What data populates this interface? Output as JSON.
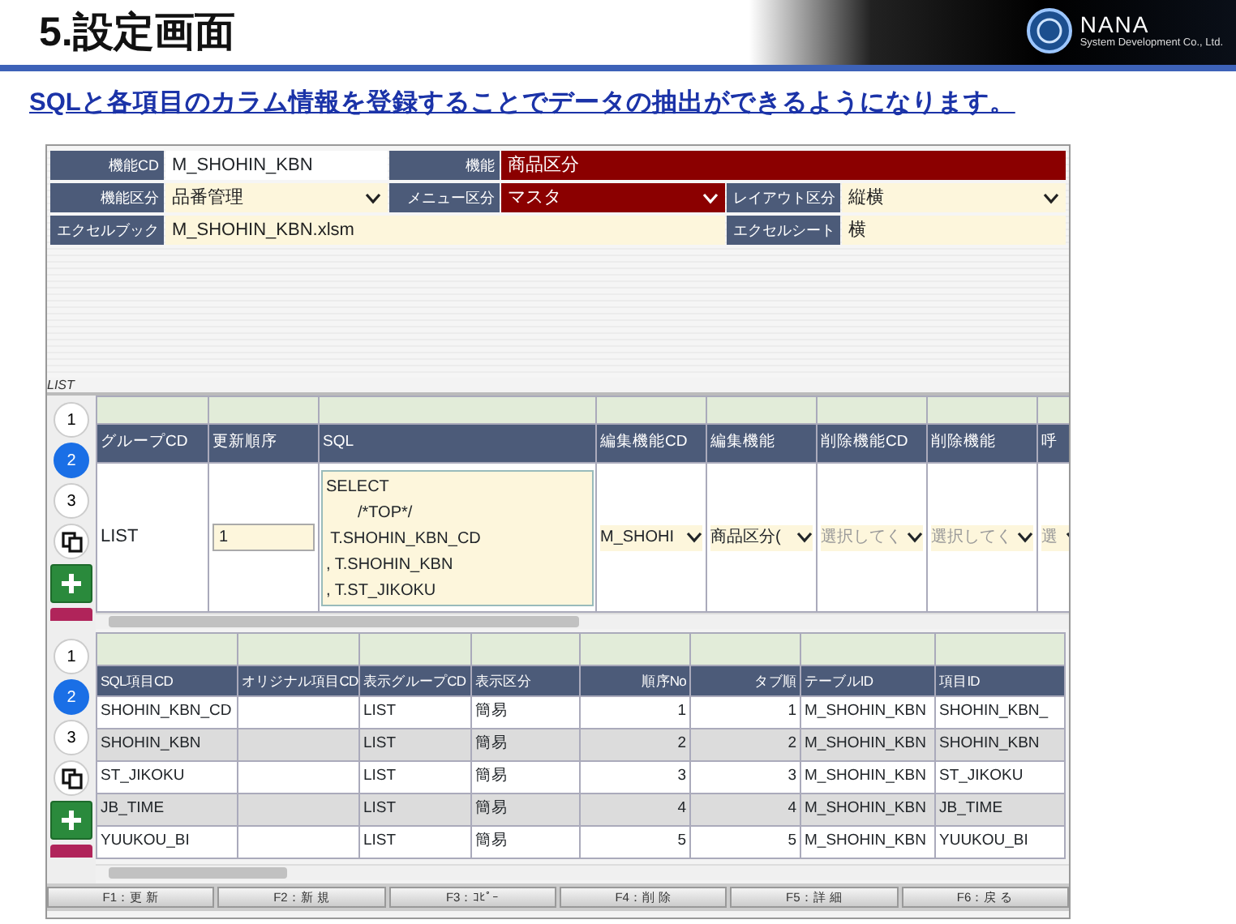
{
  "page_title": "5.設定画面",
  "logo": {
    "name": "NANA",
    "tagline": "System Development Co., Ltd."
  },
  "subtitle": "SQLと各項目のカラム情報を登録することでデータの抽出ができるようになります。",
  "form": {
    "fields": [
      {
        "label": "機能CD",
        "value": "M_SHOHIN_KBN",
        "kind": "key",
        "highlighted": false
      },
      {
        "label": "機能",
        "value": "商品区分",
        "kind": "text",
        "highlighted": true
      },
      {
        "label": "機能区分",
        "value": "品番管理",
        "kind": "select",
        "highlighted": false
      },
      {
        "label": "メニュー区分",
        "value": "マスタ",
        "kind": "select",
        "highlighted": true
      },
      {
        "label": "レイアウト区分",
        "value": "縦横",
        "kind": "select",
        "highlighted": false
      },
      {
        "label": "エクセルブック",
        "value": "M_SHOHIN_KBN.xlsm",
        "kind": "text",
        "highlighted": false
      },
      {
        "label": "エクセルシート",
        "value": "横",
        "kind": "text",
        "highlighted": false
      }
    ]
  },
  "section_label": "LIST",
  "grid_top": {
    "pages": [
      {
        "label": "1",
        "selected": false
      },
      {
        "label": "2",
        "selected": true
      },
      {
        "label": "3",
        "selected": false
      }
    ],
    "columns": [
      "グループCD",
      "更新順序",
      "SQL",
      "編集機能CD",
      "編集機能",
      "削除機能CD",
      "削除機能",
      "呼"
    ],
    "rows": [
      [
        {
          "kind": "text",
          "value": "LIST"
        },
        {
          "kind": "input",
          "value": "1"
        },
        {
          "kind": "code",
          "lines": [
            "SELECT",
            "       /*TOP*/",
            " T.SHOHIN_KBN_CD",
            ", T.SHOHIN_KBN",
            ", T.ST_JIKOKU"
          ]
        },
        {
          "kind": "select",
          "value": "M_SHOHI"
        },
        {
          "kind": "select",
          "value": "商品区分("
        },
        {
          "kind": "select",
          "placeholder": "選択してく"
        },
        {
          "kind": "select",
          "placeholder": "選択してく"
        },
        {
          "kind": "select",
          "placeholder": "選"
        }
      ]
    ]
  },
  "grid_bottom": {
    "pages": [
      {
        "label": "1",
        "selected": false
      },
      {
        "label": "2",
        "selected": true
      },
      {
        "label": "3",
        "selected": false
      }
    ],
    "columns": [
      "SQL項目CD",
      "オリジナル項目CD",
      "表示グループCD",
      "表示区分",
      "順序No",
      "タブ順",
      "テーブルID",
      "項目ID"
    ],
    "rows": [
      [
        "SHOHIN_KBN_CD",
        "",
        "LIST",
        "簡易",
        "1",
        "1",
        "M_SHOHIN_KBN",
        "SHOHIN_KBN_"
      ],
      [
        "SHOHIN_KBN",
        "",
        "LIST",
        "簡易",
        "2",
        "2",
        "M_SHOHIN_KBN",
        "SHOHIN_KBN"
      ],
      [
        "ST_JIKOKU",
        "",
        "LIST",
        "簡易",
        "3",
        "3",
        "M_SHOHIN_KBN",
        "ST_JIKOKU"
      ],
      [
        "JB_TIME",
        "",
        "LIST",
        "簡易",
        "4",
        "4",
        "M_SHOHIN_KBN",
        "JB_TIME"
      ],
      [
        "YUUKOU_BI",
        "",
        "LIST",
        "簡易",
        "5",
        "5",
        "M_SHOHIN_KBN",
        "YUUKOU_BI"
      ]
    ]
  },
  "function_keys": [
    "F1：更 新",
    "F2：新 規",
    "F3：ｺﾋﾟｰ",
    "F4：削 除",
    "F5：詳 細",
    "F6：戻 る"
  ]
}
